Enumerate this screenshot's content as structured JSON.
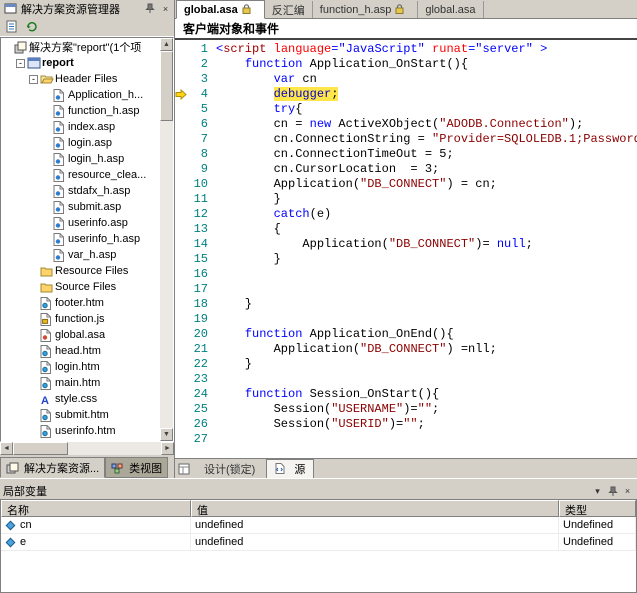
{
  "left_panel": {
    "title": "解决方案资源管理器",
    "toolbar_icons": [
      "properties-icon",
      "refresh-icon"
    ],
    "window_icons": [
      "pin-icon",
      "close-icon"
    ],
    "tree": [
      {
        "label": "解决方案\"report\"(1个项",
        "icon": "solution",
        "lvl": 0
      },
      {
        "label": "report",
        "icon": "project",
        "lvl": 1,
        "exp": "minus",
        "bold": true
      },
      {
        "label": "Header Files",
        "icon": "folderopen",
        "lvl": 2,
        "exp": "minus"
      },
      {
        "label": "Application_h...",
        "icon": "asp",
        "lvl": 3
      },
      {
        "label": "function_h.asp",
        "icon": "asp",
        "lvl": 3
      },
      {
        "label": "index.asp",
        "icon": "asp",
        "lvl": 3
      },
      {
        "label": "login.asp",
        "icon": "asp",
        "lvl": 3
      },
      {
        "label": "login_h.asp",
        "icon": "asp",
        "lvl": 3
      },
      {
        "label": "resource_clea...",
        "icon": "asp",
        "lvl": 3
      },
      {
        "label": "stdafx_h.asp",
        "icon": "asp",
        "lvl": 3
      },
      {
        "label": "submit.asp",
        "icon": "asp",
        "lvl": 3
      },
      {
        "label": "userinfo.asp",
        "icon": "asp",
        "lvl": 3
      },
      {
        "label": "userinfo_h.asp",
        "icon": "asp",
        "lvl": 3
      },
      {
        "label": "var_h.asp",
        "icon": "asp",
        "lvl": 3
      },
      {
        "label": "Resource Files",
        "icon": "folder",
        "lvl": 2
      },
      {
        "label": "Source Files",
        "icon": "folder",
        "lvl": 2
      },
      {
        "label": "footer.htm",
        "icon": "htm",
        "lvl": 2
      },
      {
        "label": "function.js",
        "icon": "js",
        "lvl": 2
      },
      {
        "label": "global.asa",
        "icon": "asa",
        "lvl": 2
      },
      {
        "label": "head.htm",
        "icon": "htm",
        "lvl": 2
      },
      {
        "label": "login.htm",
        "icon": "htm",
        "lvl": 2
      },
      {
        "label": "main.htm",
        "icon": "htm",
        "lvl": 2
      },
      {
        "label": "style.css",
        "icon": "css",
        "lvl": 2
      },
      {
        "label": "submit.htm",
        "icon": "htm",
        "lvl": 2
      },
      {
        "label": "userinfo.htm",
        "icon": "htm",
        "lvl": 2
      }
    ],
    "bottom_tabs": [
      {
        "label": "解决方案资源...",
        "icon": "solution-explorer-icon",
        "active": true
      },
      {
        "label": "类视图",
        "icon": "class-view-icon",
        "active": false
      }
    ]
  },
  "editor": {
    "tabs": [
      {
        "label": "global.asa",
        "lock": true,
        "active": true
      },
      {
        "label": "反汇编",
        "lock": false,
        "active": false
      },
      {
        "label": "function_h.asp",
        "lock": true,
        "active": false
      },
      {
        "label": "global.asa",
        "lock": false,
        "active": false
      }
    ],
    "object_bar": "客户端对象和事件",
    "current_line": 4,
    "code_lines": [
      [
        [
          "b",
          "<"
        ],
        [
          "m",
          "script"
        ],
        [
          "p",
          " "
        ],
        [
          "r",
          "language"
        ],
        [
          "b",
          "="
        ],
        [
          "b",
          "\"JavaScript\""
        ],
        [
          "p",
          " "
        ],
        [
          "r",
          "runat"
        ],
        [
          "b",
          "="
        ],
        [
          "b",
          "\"server\""
        ],
        [
          "p",
          " "
        ],
        [
          "b",
          ">"
        ]
      ],
      [
        [
          "p",
          "    "
        ],
        [
          "k",
          "function"
        ],
        [
          "p",
          " Application_OnStart(){"
        ]
      ],
      [
        [
          "p",
          "        "
        ],
        [
          "k",
          "var"
        ],
        [
          "p",
          " cn"
        ]
      ],
      [
        [
          "p",
          "        "
        ],
        [
          "kh",
          "debugger"
        ],
        [
          "ph",
          ";"
        ]
      ],
      [
        [
          "p",
          "        "
        ],
        [
          "k",
          "try"
        ],
        [
          "p",
          "{"
        ]
      ],
      [
        [
          "p",
          "        cn = "
        ],
        [
          "k",
          "new"
        ],
        [
          "p",
          " ActiveXObject("
        ],
        [
          "s",
          "\"ADODB.Connection\""
        ],
        [
          "p",
          ");"
        ]
      ],
      [
        [
          "p",
          "        cn.ConnectionString = "
        ],
        [
          "s",
          "\"Provider=SQLOLEDB.1;Password"
        ]
      ],
      [
        [
          "p",
          "        cn.ConnectionTimeOut = 5;"
        ]
      ],
      [
        [
          "p",
          "        cn.CursorLocation  = 3;"
        ]
      ],
      [
        [
          "p",
          "        Application("
        ],
        [
          "s",
          "\"DB_CONNECT\""
        ],
        [
          "p",
          ") = cn;"
        ]
      ],
      [
        [
          "p",
          "        }"
        ]
      ],
      [
        [
          "p",
          "        "
        ],
        [
          "k",
          "catch"
        ],
        [
          "p",
          "(e)"
        ]
      ],
      [
        [
          "p",
          "        {"
        ]
      ],
      [
        [
          "p",
          "            Application("
        ],
        [
          "s",
          "\"DB_CONNECT\""
        ],
        [
          "p",
          ")= "
        ],
        [
          "k",
          "null"
        ],
        [
          "p",
          ";"
        ]
      ],
      [
        [
          "p",
          "        }"
        ]
      ],
      [],
      [],
      [
        [
          "p",
          "    }"
        ]
      ],
      [],
      [
        [
          "p",
          "    "
        ],
        [
          "k",
          "function"
        ],
        [
          "p",
          " Application_OnEnd(){"
        ]
      ],
      [
        [
          "p",
          "        Application("
        ],
        [
          "s",
          "\"DB_CONNECT\""
        ],
        [
          "p",
          ") =nll;"
        ]
      ],
      [
        [
          "p",
          "    }"
        ]
      ],
      [],
      [
        [
          "p",
          "    "
        ],
        [
          "k",
          "function"
        ],
        [
          "p",
          " Session_OnStart(){"
        ]
      ],
      [
        [
          "p",
          "        Session("
        ],
        [
          "s",
          "\"USERNAME\""
        ],
        [
          "p",
          ")="
        ],
        [
          "s",
          "\"\""
        ],
        [
          "p",
          ";"
        ]
      ],
      [
        [
          "p",
          "        Session("
        ],
        [
          "s",
          "\"USERID\""
        ],
        [
          "p",
          ")="
        ],
        [
          "s",
          "\"\""
        ],
        [
          "p",
          ";"
        ]
      ],
      []
    ],
    "bottom_tabs": [
      {
        "label": "设计(锁定)",
        "active": false
      },
      {
        "label": "源",
        "active": true
      }
    ]
  },
  "locals": {
    "title": "局部变量",
    "columns": [
      "名称",
      "值",
      "类型"
    ],
    "rows": [
      [
        "cn",
        "undefined",
        "Undefined"
      ],
      [
        "e",
        "undefined",
        "Undefined"
      ]
    ]
  }
}
